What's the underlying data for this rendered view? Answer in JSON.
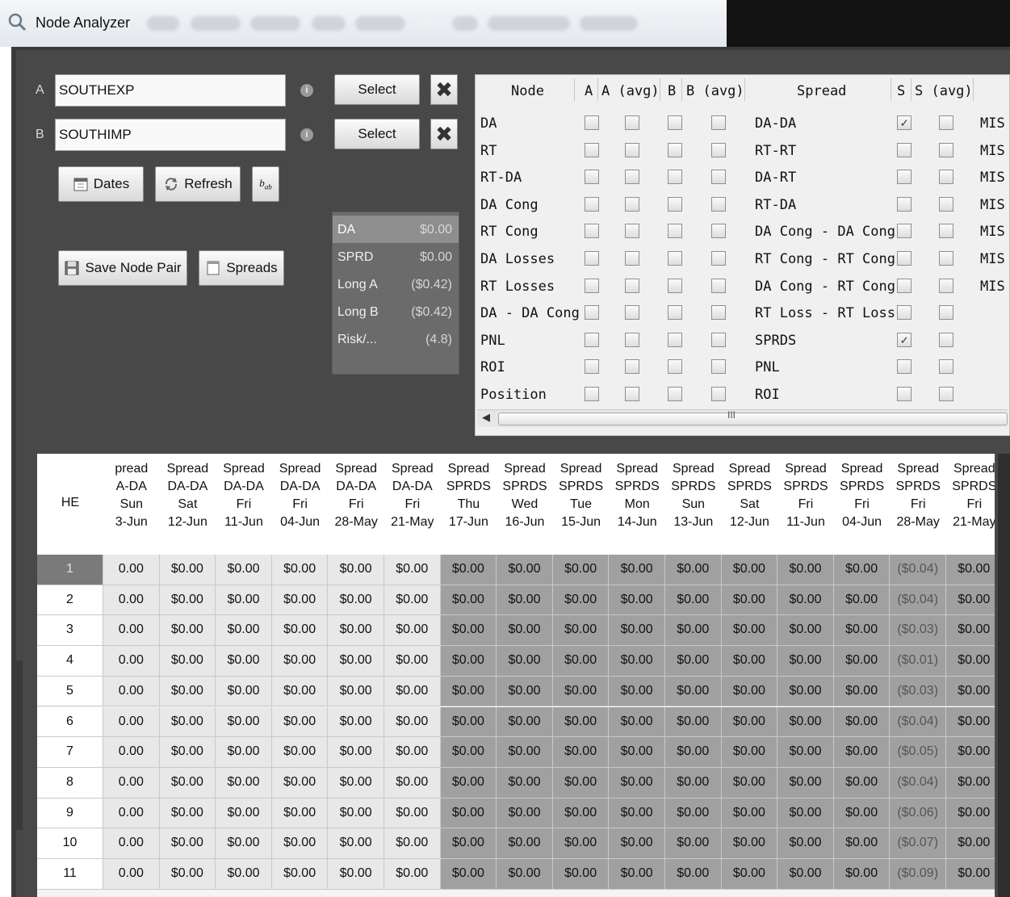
{
  "window": {
    "title": "Node Analyzer"
  },
  "inputs": {
    "a_label": "A",
    "a_value": "SOUTHEXP",
    "b_label": "B",
    "b_value": "SOUTHIMP"
  },
  "buttons": {
    "select": "Select",
    "dates": "Dates",
    "refresh": "Refresh",
    "save_node_pair": "Save Node Pair",
    "spreads": "Spreads"
  },
  "summary": [
    {
      "label": "DA",
      "value": "$0.00"
    },
    {
      "label": "SPRD",
      "value": "$0.00"
    },
    {
      "label": "Long A",
      "value": "($0.42)"
    },
    {
      "label": "Long B",
      "value": "($0.42)"
    },
    {
      "label": "Risk/...",
      "value": "(4.8)"
    }
  ],
  "grid": {
    "headers": {
      "node": "Node",
      "a": "A",
      "a_avg": "A (avg)",
      "b": "B",
      "b_avg": "B (avg)",
      "spread": "Spread",
      "s": "S",
      "s_avg": "S (avg)"
    },
    "rows": [
      {
        "node": "DA",
        "spread": "DA-DA",
        "s_checked": true,
        "extra": "MIS"
      },
      {
        "node": "RT",
        "spread": "RT-RT",
        "s_checked": false,
        "extra": "MIS"
      },
      {
        "node": "RT-DA",
        "spread": "DA-RT",
        "s_checked": false,
        "extra": "MIS"
      },
      {
        "node": "DA Cong",
        "spread": "RT-DA",
        "s_checked": false,
        "extra": "MIS"
      },
      {
        "node": "RT Cong",
        "spread": "DA Cong - DA Cong",
        "s_checked": false,
        "extra": "MIS"
      },
      {
        "node": "DA Losses",
        "spread": "RT Cong - RT Cong",
        "s_checked": false,
        "extra": "MIS"
      },
      {
        "node": "RT Losses",
        "spread": "DA Cong - RT Cong",
        "s_checked": false,
        "extra": "MIS"
      },
      {
        "node": "DA - DA Cong",
        "spread": "RT Loss - RT Loss",
        "s_checked": false,
        "extra": ""
      },
      {
        "node": "PNL",
        "spread": "SPRDS",
        "s_checked": true,
        "extra": ""
      },
      {
        "node": "ROI",
        "spread": "PNL",
        "s_checked": false,
        "extra": ""
      },
      {
        "node": "Position",
        "spread": "ROI",
        "s_checked": false,
        "extra": ""
      }
    ],
    "scroll_grip": "III"
  },
  "table": {
    "he_header": "HE",
    "columns": [
      {
        "l1": "pread",
        "l2": "A-DA",
        "l3": "Sun",
        "l4": "3-Jun",
        "kind": "da"
      },
      {
        "l1": "Spread",
        "l2": "DA-DA",
        "l3": "Sat",
        "l4": "12-Jun",
        "kind": "da"
      },
      {
        "l1": "Spread",
        "l2": "DA-DA",
        "l3": "Fri",
        "l4": "11-Jun",
        "kind": "da"
      },
      {
        "l1": "Spread",
        "l2": "DA-DA",
        "l3": "Fri",
        "l4": "04-Jun",
        "kind": "da"
      },
      {
        "l1": "Spread",
        "l2": "DA-DA",
        "l3": "Fri",
        "l4": "28-May",
        "kind": "da"
      },
      {
        "l1": "Spread",
        "l2": "DA-DA",
        "l3": "Fri",
        "l4": "21-May",
        "kind": "da"
      },
      {
        "l1": "Spread",
        "l2": "SPRDS",
        "l3": "Thu",
        "l4": "17-Jun",
        "kind": "sp"
      },
      {
        "l1": "Spread",
        "l2": "SPRDS",
        "l3": "Wed",
        "l4": "16-Jun",
        "kind": "sp"
      },
      {
        "l1": "Spread",
        "l2": "SPRDS",
        "l3": "Tue",
        "l4": "15-Jun",
        "kind": "sp"
      },
      {
        "l1": "Spread",
        "l2": "SPRDS",
        "l3": "Mon",
        "l4": "14-Jun",
        "kind": "sp"
      },
      {
        "l1": "Spread",
        "l2": "SPRDS",
        "l3": "Sun",
        "l4": "13-Jun",
        "kind": "sp"
      },
      {
        "l1": "Spread",
        "l2": "SPRDS",
        "l3": "Sat",
        "l4": "12-Jun",
        "kind": "sp"
      },
      {
        "l1": "Spread",
        "l2": "SPRDS",
        "l3": "Fri",
        "l4": "11-Jun",
        "kind": "sp"
      },
      {
        "l1": "Spread",
        "l2": "SPRDS",
        "l3": "Fri",
        "l4": "04-Jun",
        "kind": "sp"
      },
      {
        "l1": "Spread",
        "l2": "SPRDS",
        "l3": "Fri",
        "l4": "28-May",
        "kind": "sp"
      },
      {
        "l1": "Spread",
        "l2": "SPRDS",
        "l3": "Fri",
        "l4": "21-May",
        "kind": "sp"
      }
    ],
    "rows": [
      {
        "he": "1",
        "cells": [
          "0.00",
          "$0.00",
          "$0.00",
          "$0.00",
          "$0.00",
          "$0.00",
          "$0.00",
          "$0.00",
          "$0.00",
          "$0.00",
          "$0.00",
          "$0.00",
          "$0.00",
          "$0.00",
          "($0.04)",
          "$0.00"
        ]
      },
      {
        "he": "2",
        "cells": [
          "0.00",
          "$0.00",
          "$0.00",
          "$0.00",
          "$0.00",
          "$0.00",
          "$0.00",
          "$0.00",
          "$0.00",
          "$0.00",
          "$0.00",
          "$0.00",
          "$0.00",
          "$0.00",
          "($0.04)",
          "$0.00"
        ]
      },
      {
        "he": "3",
        "cells": [
          "0.00",
          "$0.00",
          "$0.00",
          "$0.00",
          "$0.00",
          "$0.00",
          "$0.00",
          "$0.00",
          "$0.00",
          "$0.00",
          "$0.00",
          "$0.00",
          "$0.00",
          "$0.00",
          "($0.03)",
          "$0.00"
        ]
      },
      {
        "he": "4",
        "cells": [
          "0.00",
          "$0.00",
          "$0.00",
          "$0.00",
          "$0.00",
          "$0.00",
          "$0.00",
          "$0.00",
          "$0.00",
          "$0.00",
          "$0.00",
          "$0.00",
          "$0.00",
          "$0.00",
          "($0.01)",
          "$0.00"
        ]
      },
      {
        "he": "5",
        "cells": [
          "0.00",
          "$0.00",
          "$0.00",
          "$0.00",
          "$0.00",
          "$0.00",
          "$0.00",
          "$0.00",
          "$0.00",
          "$0.00",
          "$0.00",
          "$0.00",
          "$0.00",
          "$0.00",
          "($0.03)",
          "$0.00"
        ]
      },
      {
        "he": "6",
        "cells": [
          "0.00",
          "$0.00",
          "$0.00",
          "$0.00",
          "$0.00",
          "$0.00",
          "$0.00",
          "$0.00",
          "$0.00",
          "$0.00",
          "$0.00",
          "$0.00",
          "$0.00",
          "$0.00",
          "($0.04)",
          "$0.00"
        ]
      },
      {
        "he": "7",
        "cells": [
          "0.00",
          "$0.00",
          "$0.00",
          "$0.00",
          "$0.00",
          "$0.00",
          "$0.00",
          "$0.00",
          "$0.00",
          "$0.00",
          "$0.00",
          "$0.00",
          "$0.00",
          "$0.00",
          "($0.05)",
          "$0.00"
        ]
      },
      {
        "he": "8",
        "cells": [
          "0.00",
          "$0.00",
          "$0.00",
          "$0.00",
          "$0.00",
          "$0.00",
          "$0.00",
          "$0.00",
          "$0.00",
          "$0.00",
          "$0.00",
          "$0.00",
          "$0.00",
          "$0.00",
          "($0.04)",
          "$0.00"
        ]
      },
      {
        "he": "9",
        "cells": [
          "0.00",
          "$0.00",
          "$0.00",
          "$0.00",
          "$0.00",
          "$0.00",
          "$0.00",
          "$0.00",
          "$0.00",
          "$0.00",
          "$0.00",
          "$0.00",
          "$0.00",
          "$0.00",
          "($0.06)",
          "$0.00"
        ]
      },
      {
        "he": "10",
        "cells": [
          "0.00",
          "$0.00",
          "$0.00",
          "$0.00",
          "$0.00",
          "$0.00",
          "$0.00",
          "$0.00",
          "$0.00",
          "$0.00",
          "$0.00",
          "$0.00",
          "$0.00",
          "$0.00",
          "($0.07)",
          "$0.00"
        ]
      },
      {
        "he": "11",
        "cells": [
          "0.00",
          "$0.00",
          "$0.00",
          "$0.00",
          "$0.00",
          "$0.00",
          "$0.00",
          "$0.00",
          "$0.00",
          "$0.00",
          "$0.00",
          "$0.00",
          "$0.00",
          "$0.00",
          "($0.09)",
          "$0.00"
        ]
      }
    ]
  },
  "colors": {
    "panel_bg": "#484848",
    "summary_bg": "#6b6b6b",
    "spread_cell": "#a0a0a0",
    "da_cell": "#e8e8e8"
  }
}
